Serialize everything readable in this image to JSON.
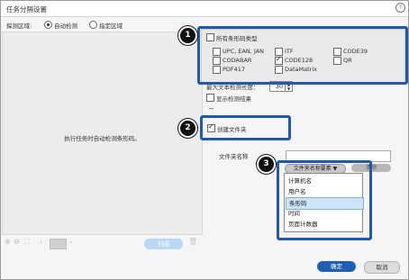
{
  "window": {
    "title": "任务分隔设置",
    "help_icon": "help-icon"
  },
  "detection_area": {
    "label": "探测区域:",
    "options": [
      {
        "label": "自动检测",
        "selected": true
      },
      {
        "label": "指定区域",
        "selected": false
      }
    ]
  },
  "preview": {
    "message": "执行任务时自动检测条形码。"
  },
  "preview_toolbar": {
    "page": "",
    "scan_label": "扫描"
  },
  "barcode_types": {
    "all_label": "所有条形码类型",
    "all_checked": false,
    "items": [
      {
        "label": "UPC, EAN, JAN",
        "checked": false
      },
      {
        "label": "ITF",
        "checked": false
      },
      {
        "label": "CODE39",
        "checked": false
      },
      {
        "label": "CODABAR",
        "checked": false
      },
      {
        "label": "CODE128",
        "checked": true
      },
      {
        "label": "QR",
        "checked": false
      },
      {
        "label": "PDF417",
        "checked": false
      },
      {
        "label": "DataMatrix",
        "checked": false
      }
    ]
  },
  "max_text_length": {
    "label": "最大文本检测长度：",
    "value": "30"
  },
  "show_results": {
    "label": "显示检测结果",
    "checked": false
  },
  "create_folder": {
    "label": "创建文件夹",
    "checked": true
  },
  "folder_name": {
    "label": "文件夹名称",
    "value": ""
  },
  "add_token_button": "文件夹名称要素 ▼",
  "clear_button": "清除",
  "token_menu": [
    {
      "label": "计算机名",
      "selected": false
    },
    {
      "label": "用户名",
      "selected": false
    },
    {
      "label": "条形码",
      "selected": true
    },
    {
      "label": "时间",
      "selected": false
    },
    {
      "label": "页面计数器",
      "selected": false
    }
  ],
  "callouts": [
    "1",
    "2",
    "3"
  ],
  "footer": {
    "ok": "确定",
    "cancel": "取消"
  },
  "colors": {
    "accent": "#1f5fb2",
    "callout": "#1e5aa8",
    "menu_selected": "#cfe3f7"
  }
}
